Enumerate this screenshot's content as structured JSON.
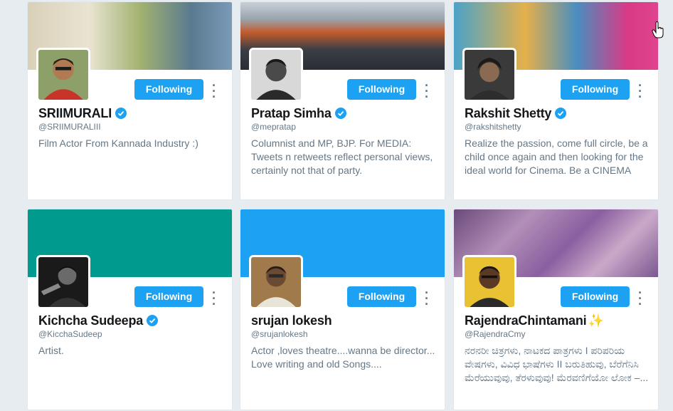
{
  "follow_label": "Following",
  "colors": {
    "accent": "#1da1f2",
    "verified": "#1da1f2",
    "teal_banner": "#009a8f",
    "background": "#e6ecf0"
  },
  "icons": {
    "verified": "verified-badge-icon",
    "more": "vertical-ellipsis-icon",
    "cursor": "hand-pointer-cursor-icon",
    "sparkle": "sparkles-icon"
  },
  "cards": [
    {
      "name": "SRIIMURALI",
      "handle": "@SRIIMURALIII",
      "verified": true,
      "bio": "Film Actor From Kannada Industry :)"
    },
    {
      "name": "Pratap Simha",
      "handle": "@mepratap",
      "verified": true,
      "bio": "Columnist and MP, BJP. For MEDIA: Tweets n retweets reflect personal views, certainly not that of party."
    },
    {
      "name": "Rakshit Shetty",
      "handle": "@rakshitshetty",
      "verified": true,
      "bio": "Realize the passion, come full circle, be a child once again and then looking for the ideal world for Cinema. Be a CINEMA"
    },
    {
      "name": "Kichcha Sudeepa",
      "handle": "@KicchaSudeep",
      "verified": true,
      "bio": "Artist."
    },
    {
      "name": "srujan lokesh",
      "handle": "@srujanlokesh",
      "verified": false,
      "bio": "Actor ,loves theatre....wanna be director... Love writing and old Songs...."
    },
    {
      "name": "RajendraChintamani",
      "name_suffix": "✨",
      "handle": "@RajendraCmy",
      "verified": false,
      "bio": "ನರನರೀ ಚಿತ್ರಗಳು, ನಾಟಕದ ಪಾತ್ರಗಳು I ಪರಿಪರಿಯ ವೇಷಗಳು, ವಿವಿಧ ಭಾಷೆಗಳು II ಬರುತಿಹುವು, ಬೆರೆಗೆನಿಸಿ ಮೆರೆಯುವುವು, ತೆರಳುವುವು! ಮೆರವಣಿಗೆಯೋ ಲೋಕ –..."
    }
  ]
}
